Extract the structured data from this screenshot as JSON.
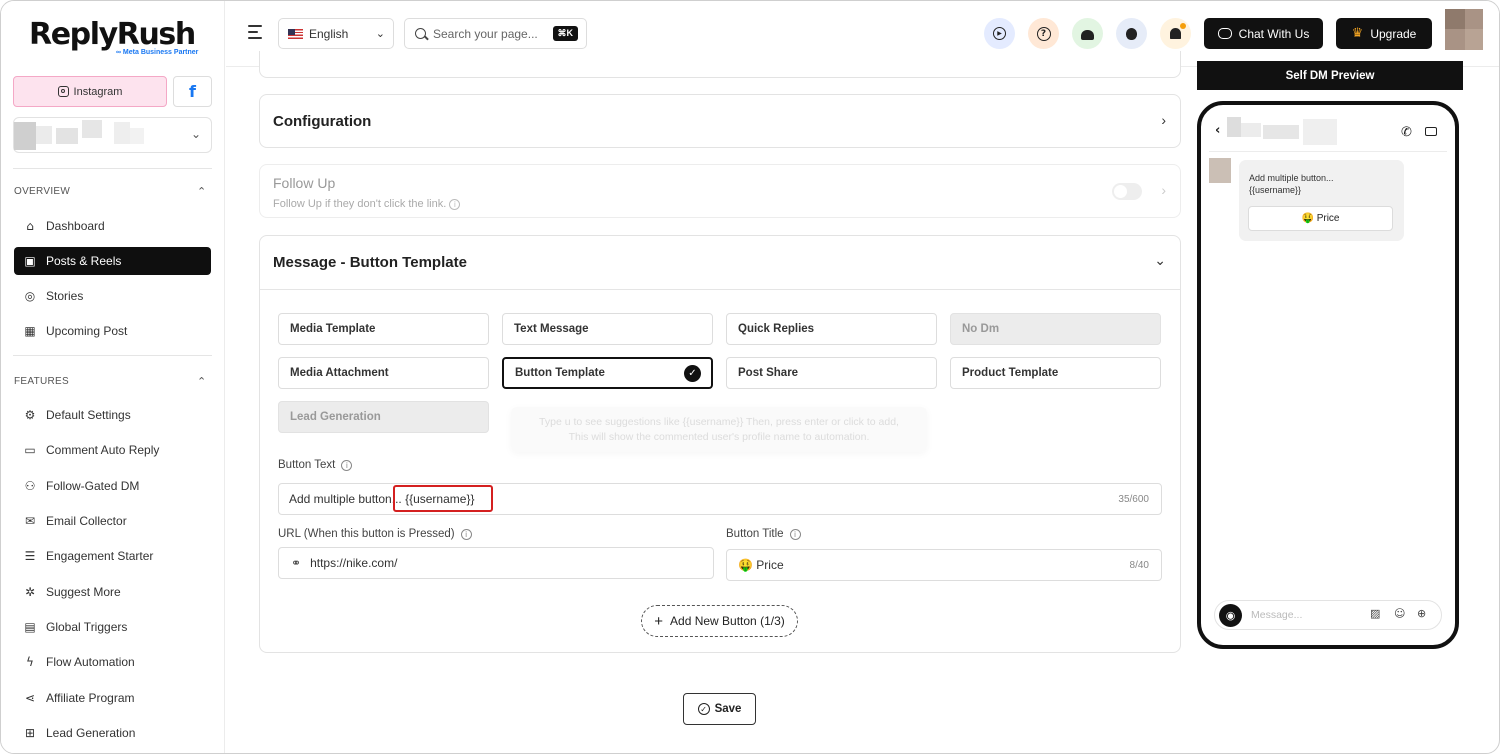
{
  "brand": {
    "name": "ReplyRush",
    "partner": "∞ Meta Business Partner"
  },
  "platforms": {
    "instagram_label": "Instagram",
    "facebook_glyph": "f"
  },
  "sections": {
    "overview": "OVERVIEW",
    "features": "FEATURES"
  },
  "nav": [
    {
      "label": "Dashboard",
      "icon": "home-icon",
      "glyph": "⌂"
    },
    {
      "label": "Posts & Reels",
      "icon": "image-icon",
      "glyph": "▣"
    },
    {
      "label": "Stories",
      "icon": "instagram-icon",
      "glyph": "◎"
    },
    {
      "label": "Upcoming Post",
      "icon": "calendar-icon",
      "glyph": "▦"
    }
  ],
  "features": [
    {
      "label": "Default Settings",
      "icon": "gear-icon",
      "glyph": "⚙"
    },
    {
      "label": "Comment Auto Reply",
      "icon": "comment-icon",
      "glyph": "▭"
    },
    {
      "label": "Follow-Gated DM",
      "icon": "users-icon",
      "glyph": "⚇"
    },
    {
      "label": "Email Collector",
      "icon": "mail-icon",
      "glyph": "✉"
    },
    {
      "label": "Engagement Starter",
      "icon": "chat-icon",
      "glyph": "☰"
    },
    {
      "label": "Suggest More",
      "icon": "cog-plus-icon",
      "glyph": "✲"
    },
    {
      "label": "Global Triggers",
      "icon": "list-icon",
      "glyph": "▤"
    },
    {
      "label": "Flow Automation",
      "icon": "bolt-icon",
      "glyph": "ϟ"
    },
    {
      "label": "Affiliate Program",
      "icon": "share-icon",
      "glyph": "⋖"
    },
    {
      "label": "Lead Generation",
      "icon": "lead-icon",
      "glyph": "⊞"
    }
  ],
  "topbar": {
    "language": "English",
    "search_placeholder": "Search your page...",
    "shortcut": "⌘K",
    "chat": "Chat With Us",
    "upgrade": "Upgrade"
  },
  "config": {
    "title": "Configuration"
  },
  "followup": {
    "title": "Follow Up",
    "subtitle": "Follow Up if they don't click the link."
  },
  "message": {
    "title": "Message - Button Template",
    "templates": [
      {
        "label": "Media Template",
        "state": "normal"
      },
      {
        "label": "Text Message",
        "state": "normal"
      },
      {
        "label": "Quick Replies",
        "state": "normal"
      },
      {
        "label": "No Dm",
        "state": "disabled"
      },
      {
        "label": "Media Attachment",
        "state": "normal"
      },
      {
        "label": "Button Template",
        "state": "selected"
      },
      {
        "label": "Post Share",
        "state": "normal"
      },
      {
        "label": "Product Template",
        "state": "normal"
      },
      {
        "label": "Lead Generation",
        "state": "disabled"
      }
    ],
    "tooltip_line1": "Type u to see suggestions like {{username}} Then, press enter or click to add,",
    "tooltip_line2": "This will show the commented user's profile name to automation.",
    "button_text_label": "Button Text",
    "button_text_value": "Add multiple button... {{username}}",
    "button_text_count": "35/600",
    "url_label": "URL (When this button is Pressed)",
    "url_value": "https://nike.com/",
    "title_label": "Button Title",
    "title_value": "🤑 Price",
    "title_count": "8/40",
    "add_button": "Add New Button (1/3)",
    "save": "Save"
  },
  "preview": {
    "header": "Self DM Preview",
    "msg_line1": "Add multiple button...",
    "msg_line2": "{{username}}",
    "msg_button": "🤑 Price",
    "composer_placeholder": "Message..."
  }
}
